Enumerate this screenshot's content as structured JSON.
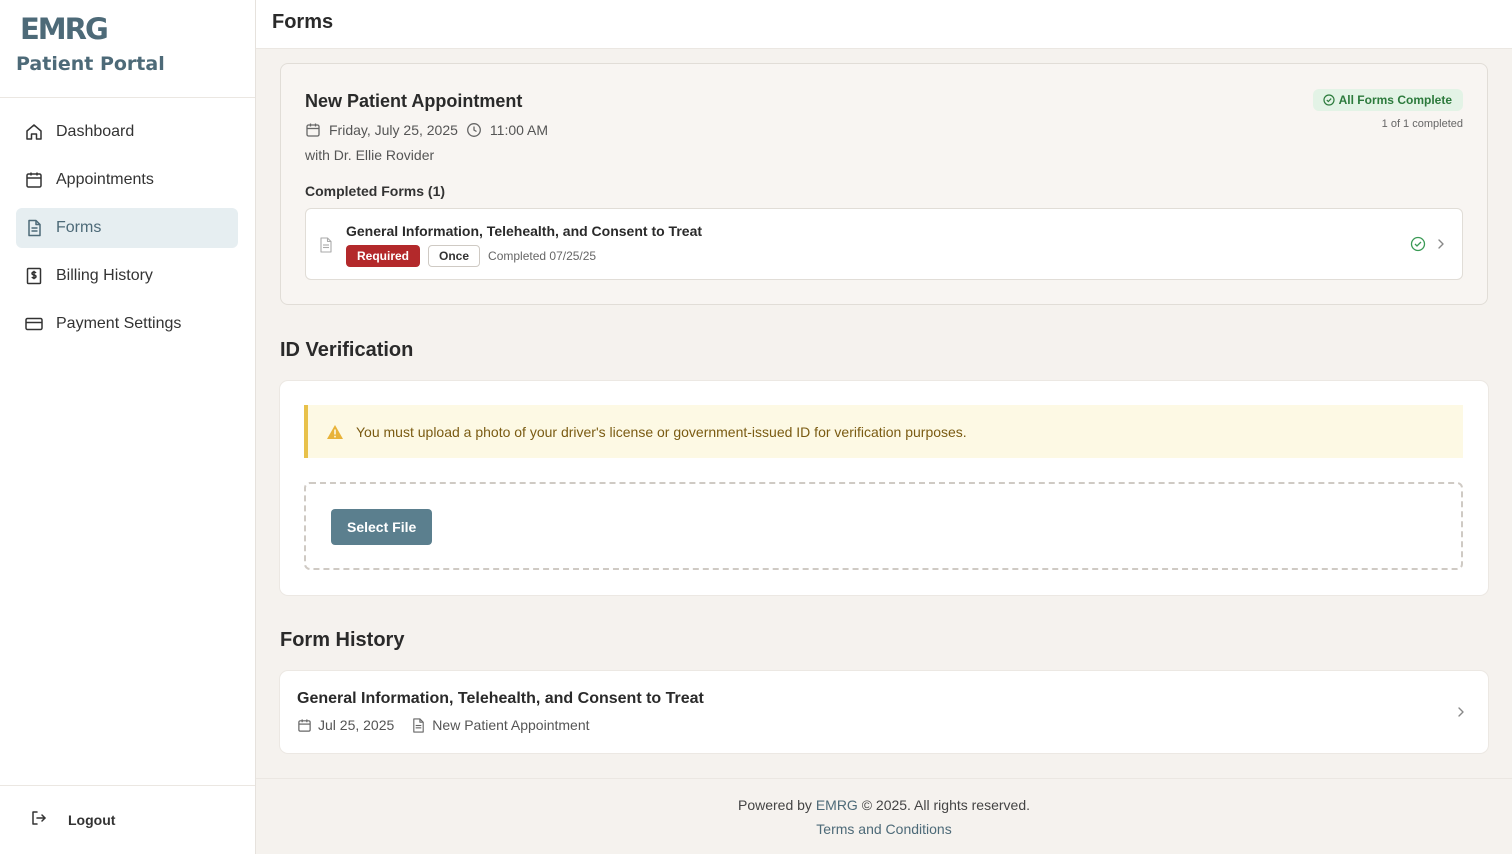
{
  "brand": {
    "logo_text": "EMRG",
    "portal_title": "Patient Portal"
  },
  "sidebar": {
    "items": [
      {
        "label": "Dashboard",
        "icon": "home-icon"
      },
      {
        "label": "Appointments",
        "icon": "calendar-icon"
      },
      {
        "label": "Forms",
        "icon": "document-icon",
        "active": true
      },
      {
        "label": "Billing History",
        "icon": "receipt-dollar-icon"
      },
      {
        "label": "Payment Settings",
        "icon": "credit-card-icon"
      }
    ],
    "logout_label": "Logout"
  },
  "header": {
    "title": "Forms"
  },
  "appointment": {
    "title": "New Patient Appointment",
    "date": "Friday, July 25, 2025",
    "time": "11:00 AM",
    "doctor": "with Dr. Ellie Rovider",
    "status_label": "All Forms Complete",
    "status_count": "1 of 1 completed",
    "completed_heading": "Completed Forms (1)",
    "forms": [
      {
        "name": "General Information, Telehealth, and Consent to Treat",
        "required_label": "Required",
        "frequency_label": "Once",
        "completed_text": "Completed 07/25/25"
      }
    ]
  },
  "id_verification": {
    "title": "ID Verification",
    "warning": "You must upload a photo of your driver's license or government-issued ID for verification purposes.",
    "select_file_label": "Select File"
  },
  "form_history": {
    "title": "Form History",
    "items": [
      {
        "name": "General Information, Telehealth, and Consent to Treat",
        "date": "Jul 25, 2025",
        "appointment": "New Patient Appointment"
      }
    ]
  },
  "footer": {
    "powered_prefix": "Powered by",
    "brand_link": "EMRG",
    "copyright": "© 2025. All rights reserved.",
    "terms_label": "Terms and Conditions"
  },
  "colors": {
    "brand": "#4d6a78",
    "active_bg": "#e6eef1",
    "success": "#2c7a3c",
    "danger": "#b3292b",
    "warning": "#e8c14a",
    "button": "#5b7f8e"
  }
}
